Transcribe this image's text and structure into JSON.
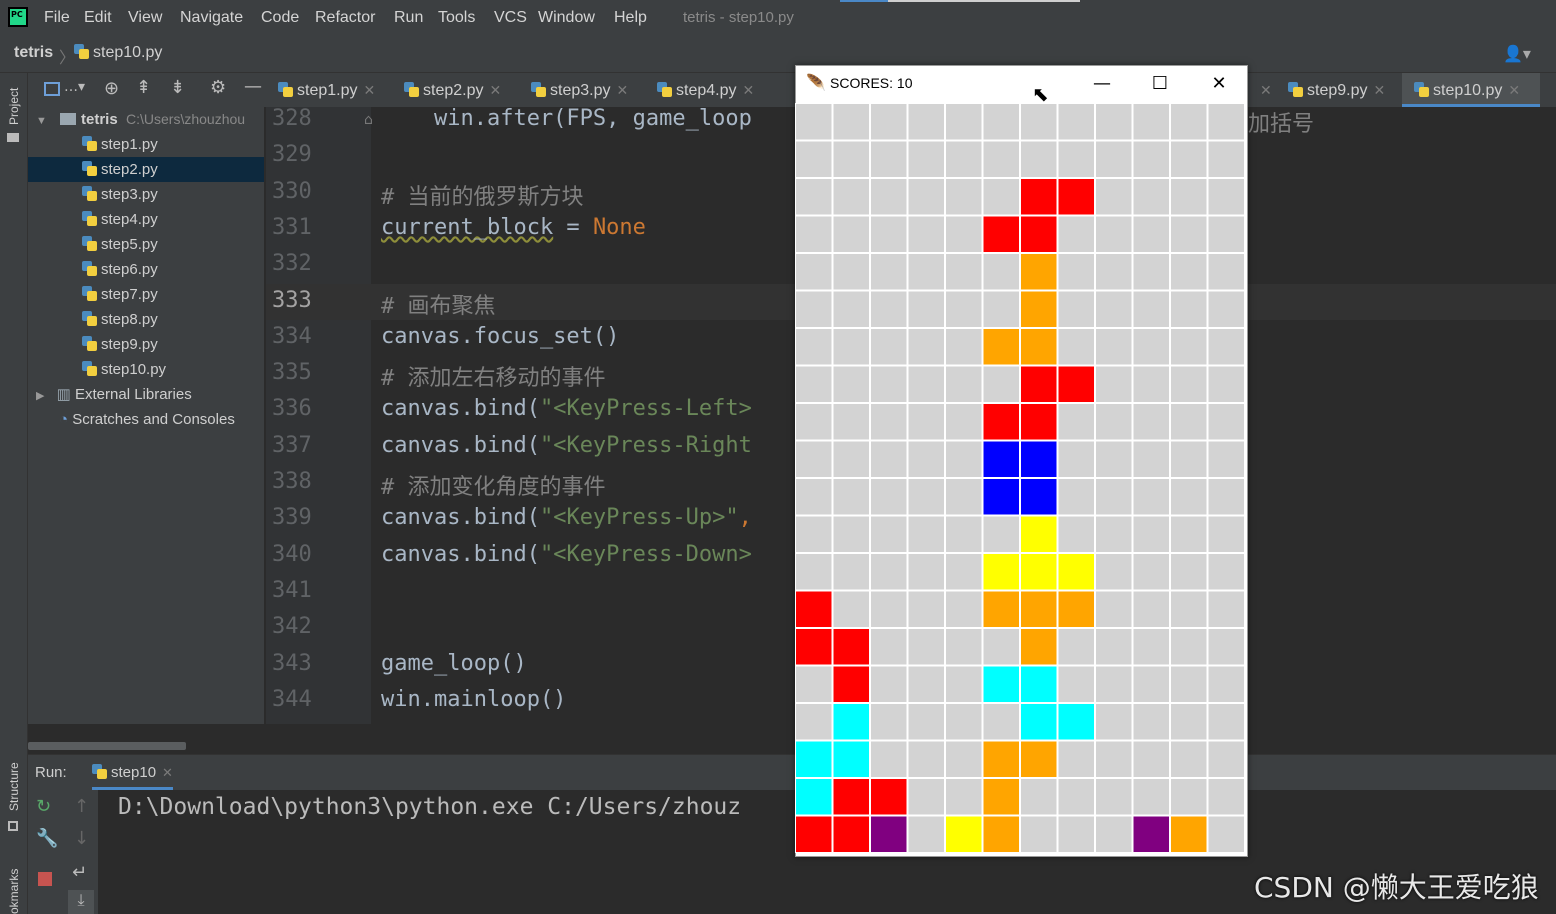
{
  "menu": {
    "items": [
      "File",
      "Edit",
      "View",
      "Navigate",
      "Code",
      "Refactor",
      "Run",
      "Tools",
      "VCS",
      "Window",
      "Help"
    ],
    "window_title": "tetris - step10.py"
  },
  "breadcrumb": {
    "project": "tetris",
    "file": "step10.py"
  },
  "side_labels": {
    "project": "Project",
    "structure": "Structure",
    "bookmarks": "okmarks"
  },
  "project_tree": {
    "root": "tetris",
    "root_path": "C:\\Users\\zhouzhou",
    "files": [
      "step1.py",
      "step2.py",
      "step3.py",
      "step4.py",
      "step5.py",
      "step6.py",
      "step7.py",
      "step8.py",
      "step9.py",
      "step10.py"
    ],
    "selected": "step2.py",
    "external": "External Libraries",
    "scratches": "Scratches and Consoles"
  },
  "tabs": [
    "step1.py",
    "step2.py",
    "step3.py",
    "step4.py",
    "step9.py",
    "step10.py"
  ],
  "active_tab": "step10.py",
  "editor": {
    "current_line": "333",
    "lines": [
      {
        "num": "328",
        "parts": [
          {
            "t": "    win.after(FPS, game_loop",
            "c": "plain"
          }
        ]
      },
      {
        "num": "329",
        "parts": []
      },
      {
        "num": "330",
        "parts": [
          {
            "t": "# 当前的俄罗斯方块",
            "c": "cm"
          }
        ]
      },
      {
        "num": "331",
        "parts": [
          {
            "t": "current_block",
            "c": "wavy"
          },
          {
            "t": " = ",
            "c": "plain"
          },
          {
            "t": "None",
            "c": "kw"
          }
        ]
      },
      {
        "num": "332",
        "parts": []
      },
      {
        "num": "333",
        "parts": [
          {
            "t": "# 画布聚焦",
            "c": "cm"
          }
        ]
      },
      {
        "num": "334",
        "parts": [
          {
            "t": "canvas.focus_set()",
            "c": "plain"
          }
        ]
      },
      {
        "num": "335",
        "parts": [
          {
            "t": "# 添加左右移动的事件",
            "c": "cm"
          }
        ]
      },
      {
        "num": "336",
        "parts": [
          {
            "t": "canvas.bind(",
            "c": "plain"
          },
          {
            "t": "\"<KeyPress-Left>",
            "c": "str"
          }
        ]
      },
      {
        "num": "337",
        "parts": [
          {
            "t": "canvas.bind(",
            "c": "plain"
          },
          {
            "t": "\"<KeyPress-Right",
            "c": "str"
          }
        ]
      },
      {
        "num": "338",
        "parts": [
          {
            "t": "# 添加变化角度的事件",
            "c": "cm"
          }
        ]
      },
      {
        "num": "339",
        "parts": [
          {
            "t": "canvas.bind(",
            "c": "plain"
          },
          {
            "t": "\"<KeyPress-Up>\"",
            "c": "str"
          },
          {
            "t": ",",
            "c": "kw"
          }
        ]
      },
      {
        "num": "340",
        "parts": [
          {
            "t": "canvas.bind(",
            "c": "plain"
          },
          {
            "t": "\"<KeyPress-Down>",
            "c": "str"
          }
        ]
      },
      {
        "num": "341",
        "parts": []
      },
      {
        "num": "342",
        "parts": []
      },
      {
        "num": "343",
        "parts": [
          {
            "t": "game_loop()",
            "c": "plain"
          }
        ]
      },
      {
        "num": "344",
        "parts": [
          {
            "t": "win.mainloop()",
            "c": "plain"
          }
        ]
      }
    ],
    "right_fragment": "加括号"
  },
  "run": {
    "label": "Run:",
    "tab": "step10",
    "console": "D:\\Download\\python3\\python.exe C:/Users/zhouz"
  },
  "tetris": {
    "title": "SCORES: 10",
    "minimize": "—",
    "maximize": "☐",
    "close": "✕",
    "grid_bg": "#d3d3d3",
    "colors": {
      "R": "#ff0000",
      "O": "#ffa500",
      "B": "#0000ff",
      "Y": "#ffff00",
      "C": "#00ffff",
      "P": "#800080"
    },
    "rows": [
      "............",
      "............",
      "......RR....",
      ".....RR.....",
      "......O.....",
      "......O.....",
      ".....OO.....",
      "......RR....",
      ".....RR.....",
      ".....BB.....",
      ".....BB.....",
      "......Y.....",
      ".....YYY....",
      "R....OOO....",
      "RR....O.....",
      ".R...CC.....",
      ".C....CC....",
      "CC...OO.....",
      "CRR..O......",
      "RRP.YO...PO."
    ]
  },
  "watermark": "CSDN @懒大王爱吃狼"
}
